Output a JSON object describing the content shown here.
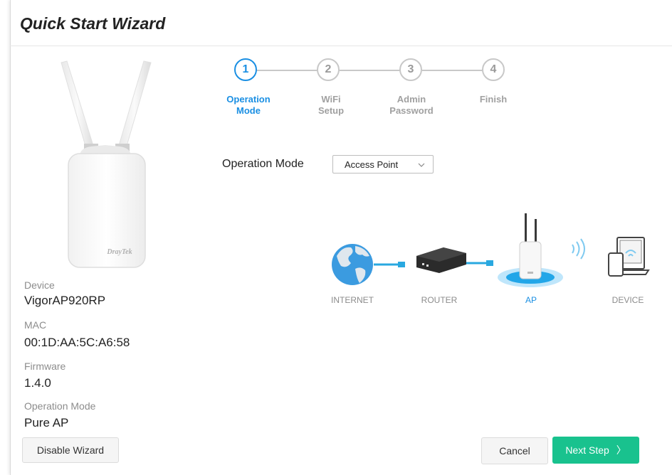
{
  "window": {
    "title": "Quick Start Wizard"
  },
  "device_image": {
    "brand_text": "DrayTek"
  },
  "stepper": {
    "steps": [
      {
        "number": "1",
        "label_line1": "Operation",
        "label_line2": "Mode",
        "active": true
      },
      {
        "number": "2",
        "label_line1": "WiFi",
        "label_line2": "Setup",
        "active": false
      },
      {
        "number": "3",
        "label_line1": "Admin",
        "label_line2": "Password",
        "active": false
      },
      {
        "number": "4",
        "label_line1": "Finish",
        "label_line2": "",
        "active": false
      }
    ]
  },
  "operation_mode": {
    "label": "Operation Mode",
    "selected": "Access Point"
  },
  "diagram": {
    "internet_label": "INTERNET",
    "router_label": "ROUTER",
    "ap_label": "AP",
    "device_label": "DEVICE"
  },
  "info": {
    "device_label": "Device",
    "device_value": "VigorAP920RP",
    "mac_label": "MAC",
    "mac_value": "00:1D:AA:5C:A6:58",
    "firmware_label": "Firmware",
    "firmware_value": "1.4.0",
    "opmode_label": "Operation Mode",
    "opmode_value": "Pure AP"
  },
  "buttons": {
    "disable_wizard": "Disable Wizard",
    "cancel": "Cancel",
    "next_step": "Next Step",
    "next_chevron": "〉"
  },
  "colors": {
    "accent": "#1a8fe3",
    "primary_button": "#19c28e"
  }
}
